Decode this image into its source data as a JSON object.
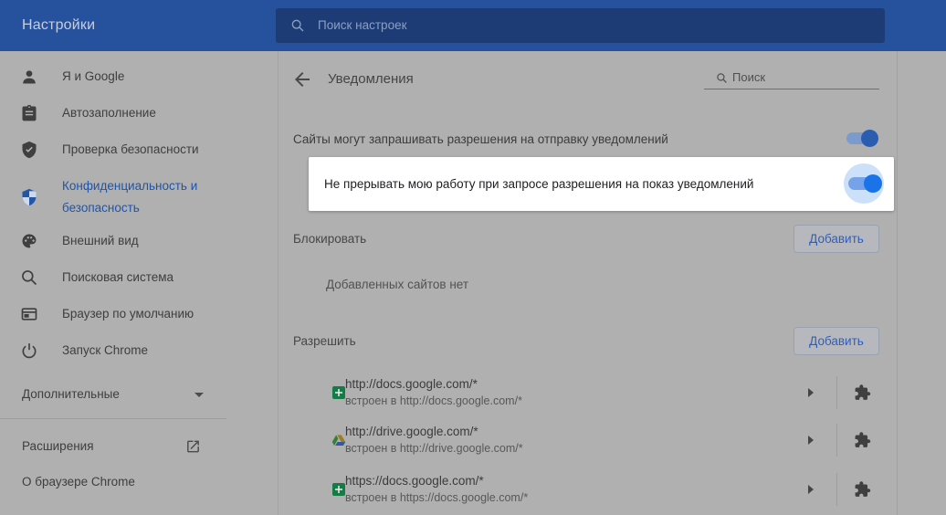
{
  "topbar": {
    "title": "Настройки",
    "search_placeholder": "Поиск настроек"
  },
  "sidebar": {
    "items": [
      {
        "icon": "person-icon",
        "label": "Я и Google"
      },
      {
        "icon": "autofill-icon",
        "label": "Автозаполнение"
      },
      {
        "icon": "safety-check-icon",
        "label": "Проверка безопасности"
      },
      {
        "icon": "privacy-shield-icon",
        "label": "Конфиденциальность и безопасность",
        "active": true
      },
      {
        "icon": "palette-icon",
        "label": "Внешний вид"
      },
      {
        "icon": "search-icon",
        "label": "Поисковая система"
      },
      {
        "icon": "browser-icon",
        "label": "Браузер по умолчанию"
      },
      {
        "icon": "power-icon",
        "label": "Запуск Chrome"
      }
    ],
    "more_label": "Дополнительные",
    "extensions_label": "Расширения",
    "about_label": "О браузере Chrome"
  },
  "content": {
    "title": "Уведомления",
    "search_placeholder": "Поиск",
    "permission_row": {
      "label": "Сайты могут запрашивать разрешения на отправку уведомлений",
      "enabled": true
    },
    "highlight_row": {
      "label": "Не прерывать мою работу при запросе разрешения на показ уведомлений",
      "enabled": true
    },
    "block_section": {
      "label": "Блокировать",
      "button": "Добавить",
      "empty_text": "Добавленных сайтов нет"
    },
    "allow_section": {
      "label": "Разрешить",
      "button": "Добавить",
      "sites": [
        {
          "icon": "sheets-icon",
          "url": "http://docs.google.com/*",
          "detail": "встроен в http://docs.google.com/*"
        },
        {
          "icon": "drive-icon",
          "url": "http://drive.google.com/*",
          "detail": "встроен в http://drive.google.com/*"
        },
        {
          "icon": "sheets-icon",
          "url": "https://docs.google.com/*",
          "detail": "встроен в https://docs.google.com/*"
        }
      ]
    }
  },
  "colors": {
    "accent_blue": "#1a73e8",
    "toggle_track_on": "#8ab4f8",
    "toggle_halo": "#d2e3fc",
    "toolbar_blue_dimmed": "#26519d",
    "spotlight_bg": "#ffffff",
    "dim_overlay_gray": "#b0b0b0"
  }
}
